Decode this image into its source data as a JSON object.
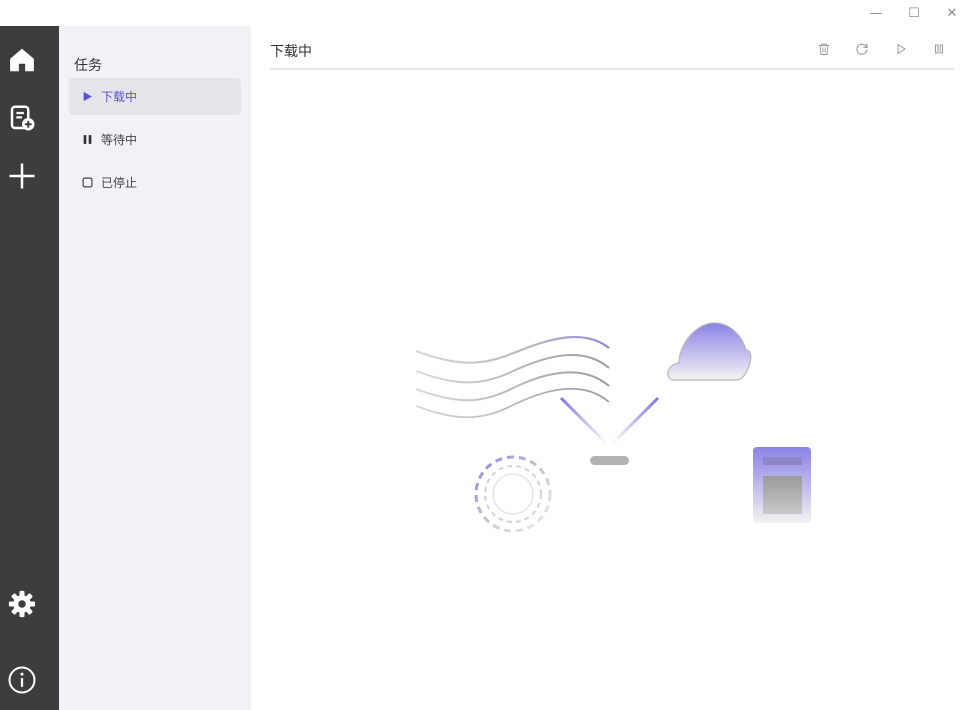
{
  "window": {
    "minimize_glyph": "—",
    "maximize_glyph": "☐",
    "close_glyph": "✕"
  },
  "rail": {
    "icons": [
      "home-icon",
      "new-task-icon",
      "add-icon",
      "settings-icon",
      "info-icon"
    ]
  },
  "sidebar": {
    "title": "任务",
    "items": [
      {
        "label": "下载中",
        "icon": "play-icon",
        "active": true
      },
      {
        "label": "等待中",
        "icon": "pause-icon",
        "active": false
      },
      {
        "label": "已停止",
        "icon": "stop-icon",
        "active": false
      }
    ]
  },
  "main": {
    "title": "下载中",
    "toolbar": [
      "delete-icon",
      "refresh-icon",
      "resume-all-icon",
      "pause-all-icon"
    ]
  },
  "colors": {
    "accent": "#5b52cf",
    "rail": "#3d3d3d",
    "sidebar": "#f1f2f6"
  }
}
